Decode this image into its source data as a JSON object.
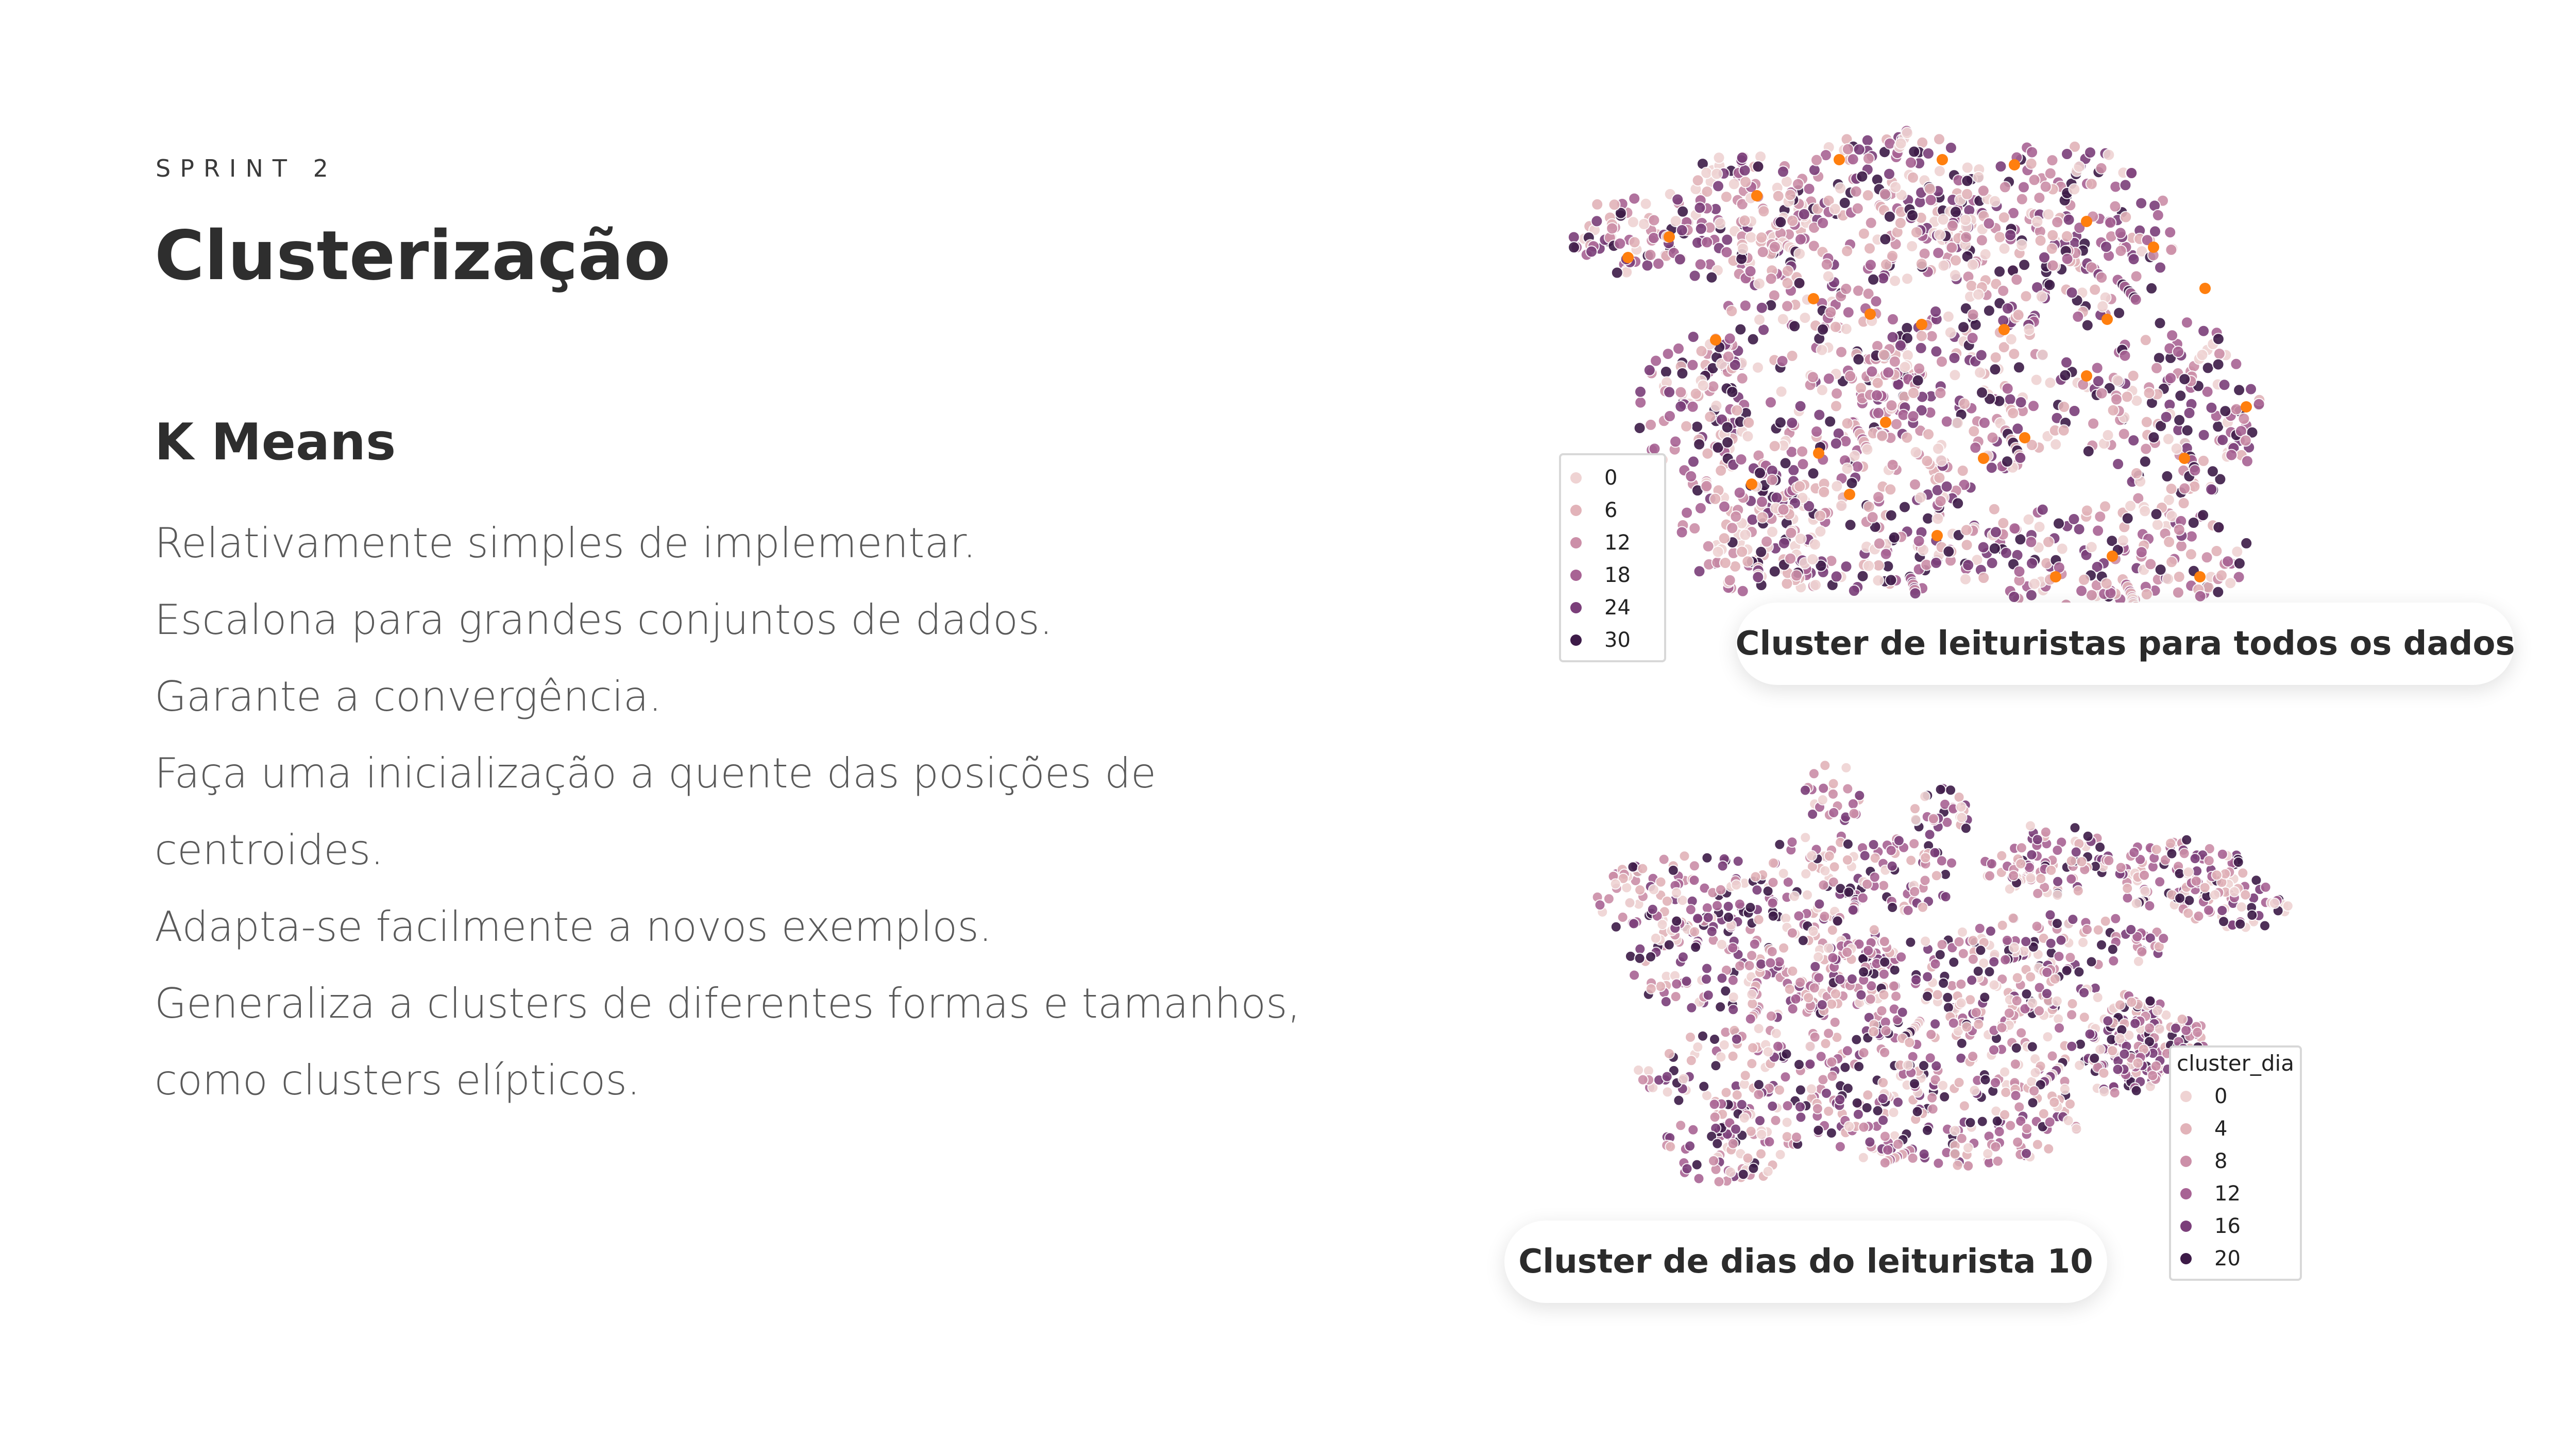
{
  "slide": {
    "eyebrow": "SPRINT 2",
    "title": "Clusterização",
    "subtitle": "K Means",
    "lines": [
      "Relativamente simples de implementar.",
      "Escalona para grandes conjuntos de dados.",
      "Garante a convergência.",
      "Faça uma inicialização a quente das posições de",
      "centroides.",
      "Adapta-se facilmente a novos exemplos.",
      "Generaliza a clusters de diferentes formas e tamanhos,",
      "como clusters elípticos."
    ]
  },
  "colors": {
    "palette": [
      "#efd3d3",
      "#e2b3b9",
      "#cc8fa8",
      "#a86394",
      "#7b3f7a",
      "#3d1b48"
    ],
    "centroid": "#ff7f0e"
  },
  "chart_data": [
    {
      "type": "scatter",
      "caption": "Cluster de leituristas para todos os dados",
      "legend_title": "",
      "legend": [
        "0",
        "6",
        "12",
        "18",
        "24",
        "30"
      ],
      "legend_placement": "left",
      "hue_range": [
        0,
        33
      ],
      "centroids_shown": true
    },
    {
      "type": "scatter",
      "caption": "Cluster de dias do leiturista  10",
      "legend_title": "cluster_dia",
      "legend": [
        "0",
        "4",
        "8",
        "12",
        "16",
        "20"
      ],
      "legend_placement": "right",
      "hue_range": [
        0,
        22
      ],
      "centroids_shown": false
    }
  ]
}
